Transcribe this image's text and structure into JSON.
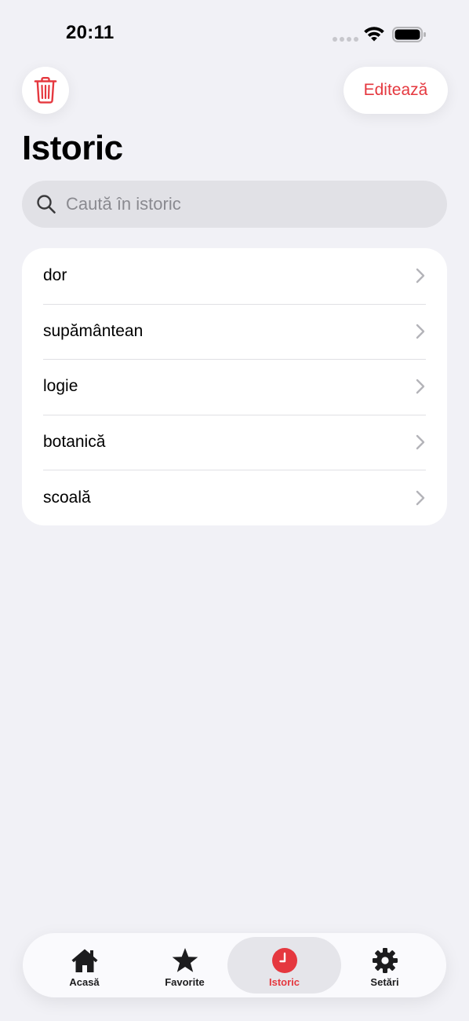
{
  "status_bar": {
    "time": "20:11"
  },
  "toolbar": {
    "edit_label": "Editează"
  },
  "page": {
    "title": "Istoric"
  },
  "search": {
    "placeholder": "Caută în istoric"
  },
  "history": {
    "items": [
      {
        "label": "dor"
      },
      {
        "label": "supământean"
      },
      {
        "label": "logie"
      },
      {
        "label": "botanică"
      },
      {
        "label": "scoală"
      }
    ]
  },
  "tab_bar": {
    "tabs": [
      {
        "label": "Acasă",
        "icon": "house-icon",
        "active": false
      },
      {
        "label": "Favorite",
        "icon": "star-icon",
        "active": false
      },
      {
        "label": "Istoric",
        "icon": "clock-icon",
        "active": true
      },
      {
        "label": "Setări",
        "icon": "gear-icon",
        "active": false
      }
    ]
  },
  "colors": {
    "accent": "#e5383f",
    "background": "#f1f1f6"
  }
}
